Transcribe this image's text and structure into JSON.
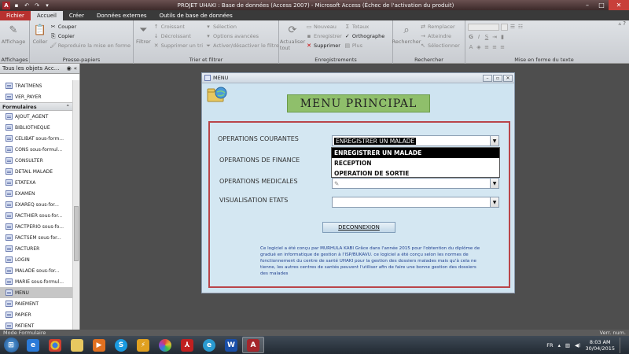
{
  "window": {
    "title": "PROJET UHAKI : Base de données (Access 2007) - Microsoft Access (Échec de l'activation du produit)"
  },
  "ribbon": {
    "tabs": [
      "Fichier",
      "Accueil",
      "Créer",
      "Données externes",
      "Outils de base de données"
    ],
    "groups": {
      "affichages": {
        "name": "Affichages",
        "affichage": "Affichage"
      },
      "presse": {
        "name": "Presse-papiers",
        "coller": "Coller",
        "couper": "Couper",
        "copier": "Copier",
        "reproduire": "Reproduire la mise en forme"
      },
      "trier": {
        "name": "Trier et filtrer",
        "filtrer": "Filtrer",
        "croissant": "Croissant",
        "decroissant": "Décroissant",
        "supprimer_tri": "Supprimer un tri",
        "selection": "Sélection",
        "options": "Options avancées",
        "activer": "Activer/désactiver le filtre"
      },
      "enreg": {
        "name": "Enregistrements",
        "actualiser": "Actualiser tout",
        "nouveau": "Nouveau",
        "enregistrer": "Enregistrer",
        "supprimer": "Supprimer",
        "totaux": "Totaux",
        "orthographe": "Orthographe",
        "plus": "Plus"
      },
      "recherche": {
        "name": "Rechercher",
        "rechercher": "Rechercher",
        "remplacer": "Remplacer",
        "atteindre": "Atteindre",
        "selectionner": "Sélectionner"
      },
      "texte": {
        "name": "Mise en forme du texte"
      }
    }
  },
  "navpane": {
    "header": "Tous les objets Acc...",
    "items_top": [
      "TRAITMENS",
      "VER_PAYER"
    ],
    "section": "Formulaires",
    "forms": [
      "AJOUT_AGENT",
      "BIBLIOTHEQUE",
      "CELIBAT sous-form...",
      "CONS sous-formul...",
      "CONSULTER",
      "DETAIL MALADE",
      "ETATEXA",
      "EXAMEN",
      "EXAREQ sous-for...",
      "FACTHIER sous-for...",
      "FACTPERIO sous-fo...",
      "FACTSEM sous-for...",
      "FACTURER",
      "LOGIN",
      "MALADE sous-for...",
      "MARIE sous-formul...",
      "MENU",
      "PAIEMENT",
      "PAPIER",
      "PATIENT"
    ],
    "selected": "MENU"
  },
  "form": {
    "window_title": "MENU",
    "header": "MENU PRINCIPAL",
    "operations_courantes_label": "OPERATIONS COURANTES",
    "operations_courantes_value": "ENREGISTRER UN MALADE",
    "operations_finance_label": "OPERATIONS DE FINANCE",
    "operations_medicales_label": "OPERATIONS MEDICALES",
    "visualisation_label": "VISUALISATION ETATS",
    "dropdown_options": [
      "ENREGISTRER UN MALADE",
      "RECEPTION",
      "OPERATION DE SORTIE"
    ],
    "deconnexion_label": "DECONNEXION",
    "info_text": "Ce logiciel a été conçu par MURHULA KABI Grâce dans l'année 2015 pour l'obtention du diplôme de gradué en informatique de gestion à l'ISP/BUKAVU. ce logiciel a été conçu selon les normes de fonctionnement du centre de santé UHAKI pour la gestion des dossiers malades mais qu'à cela ne tienne, les autres centres de santés peuvent l'utiliser afin de faire une bonne gestion des dossiers des malades"
  },
  "status": {
    "left": "Mode Formulaire",
    "right": "Verr. num."
  },
  "taskbar": {
    "lang": "FR",
    "time": "8:03 AM",
    "date": "30/04/2015",
    "apps": [
      "start",
      "ie",
      "chrome",
      "explorer",
      "media",
      "skype",
      "winamp",
      "picasa",
      "acrobat",
      "ie-edge",
      "word",
      "access"
    ]
  },
  "colors": {
    "accent_red": "#b8312f",
    "form_bg": "#cfe4f1",
    "header_green": "#8fbf6b",
    "panel_border": "#b9454a"
  }
}
